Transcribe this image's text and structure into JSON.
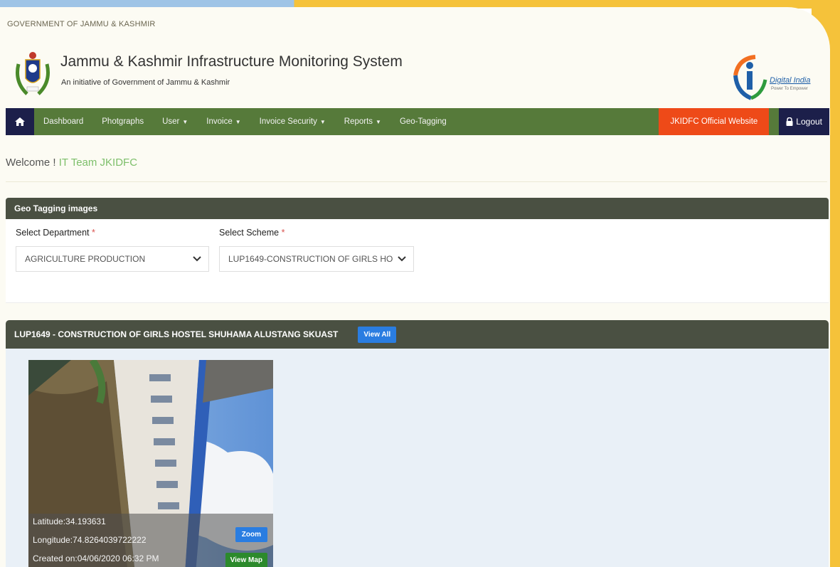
{
  "gov_title": "GOVERNMENT OF JAMMU & KASHMIR",
  "header": {
    "title": "Jammu & Kashmir Infrastructure Monitoring System",
    "subtitle": "An initiative of Government of Jammu & Kashmir",
    "digital_india": "Digital India",
    "digital_india_tag": "Power To Empower"
  },
  "nav": {
    "items": [
      {
        "label": "Dashboard",
        "dropdown": false
      },
      {
        "label": "Photgraphs",
        "dropdown": false
      },
      {
        "label": "User",
        "dropdown": true
      },
      {
        "label": "Invoice",
        "dropdown": true
      },
      {
        "label": "Invoice Security",
        "dropdown": true
      },
      {
        "label": "Reports",
        "dropdown": true
      },
      {
        "label": "Geo-Tagging",
        "dropdown": false
      }
    ],
    "official": "JKIDFC Official Website",
    "logout": "Logout"
  },
  "welcome": {
    "prefix": "Welcome !",
    "name": "IT Team JKIDFC"
  },
  "geo_card": {
    "title": "Geo Tagging images",
    "dept_label": "Select Department",
    "dept_value": "AGRICULTURE PRODUCTION",
    "scheme_label": "Select Scheme",
    "scheme_value": "LUP1649-CONSTRUCTION OF GIRLS HO",
    "required_mark": "*"
  },
  "scheme_card": {
    "title": "LUP1649 - CONSTRUCTION OF GIRLS HOSTEL SHUHAMA ALUSTANG SKUAST",
    "view_all": "View All",
    "photo": {
      "latitude": "Latitude:34.193631",
      "longitude": "Longitude:74.8264039722222",
      "created": "Created on:04/06/2020 06:32 PM",
      "zoom": "Zoom",
      "view_map": "View Map"
    }
  },
  "colors": {
    "navbar": "#567a3a",
    "nav_dark": "#1c1f4a",
    "official": "#ee4a18",
    "card_header": "#4a5042",
    "accent_blue": "#2a7de1",
    "map_green": "#2c8a2c"
  }
}
